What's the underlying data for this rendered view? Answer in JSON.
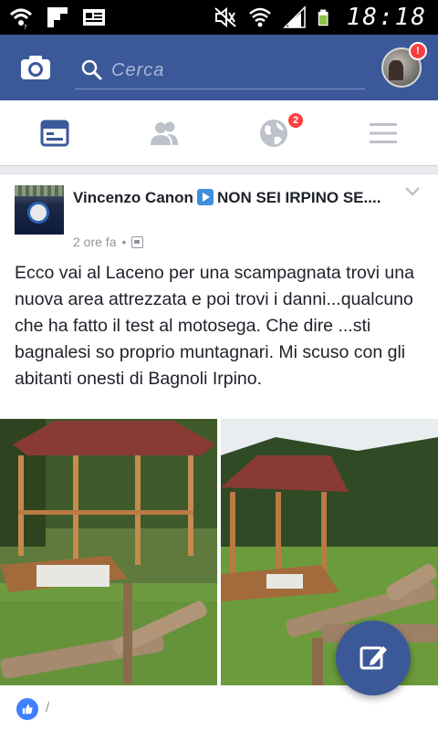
{
  "status_bar": {
    "time": "18:18",
    "icons": [
      "wifi-icon",
      "flipboard-icon",
      "news-icon",
      "mute-icon",
      "wifi-signal-icon",
      "cell-signal-icon",
      "battery-icon"
    ]
  },
  "header": {
    "search_placeholder": "Cerca",
    "profile_badge": "!",
    "brand_color": "#3b5998"
  },
  "tabs": [
    {
      "name": "news-feed",
      "icon": "news-feed-icon",
      "active": true
    },
    {
      "name": "friends",
      "icon": "friends-icon",
      "active": false
    },
    {
      "name": "notifications",
      "icon": "globe-icon",
      "badge": "2",
      "active": false
    },
    {
      "name": "more",
      "icon": "menu-icon",
      "active": false
    }
  ],
  "post": {
    "author": "Vincenzo Canon",
    "group": "NON SEI  IRPINO SE....",
    "time": "2 ore fa",
    "separator": "•",
    "text": "Ecco vai al Laceno per una scampagnata trovi una nuova area attrezzata e poi trovi i danni...qualcuno che ha fatto il test al motosega. Che dire ...sti bagnalesi so proprio muntagnari. Mi scuso con gli abitanti onesti di Bagnoli Irpino.",
    "photos": [
      "gazebo-damaged-fence-photo-1",
      "gazebo-damaged-fence-photo-2"
    ],
    "reactions": "/"
  }
}
